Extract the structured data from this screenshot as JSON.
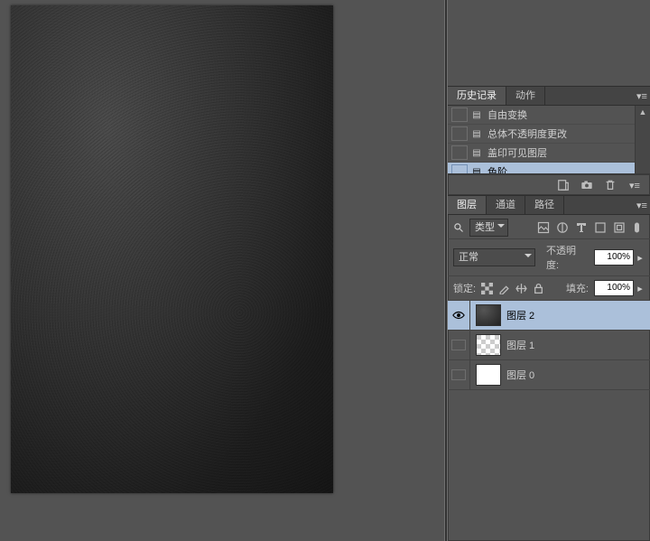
{
  "history_panel": {
    "tabs": {
      "history": "历史记录",
      "actions": "动作"
    },
    "items": [
      {
        "label": "自由变换"
      },
      {
        "label": "总体不透明度更改"
      },
      {
        "label": "盖印可见图层"
      },
      {
        "label": "色阶"
      }
    ],
    "selected_index": 3
  },
  "layers_panel": {
    "tabs": {
      "layers": "图层",
      "channels": "通道",
      "paths": "路径"
    },
    "filter_kind": "类型",
    "blend_mode": "正常",
    "opacity_label": "不透明度:",
    "opacity_value": "100%",
    "lock_label": "锁定:",
    "fill_label": "填充:",
    "fill_value": "100%",
    "layers": [
      {
        "name": "图层 2",
        "thumb": "dark",
        "visible": true
      },
      {
        "name": "图层 1",
        "thumb": "checker",
        "visible": false
      },
      {
        "name": "图层 0",
        "thumb": "white",
        "visible": false
      }
    ],
    "selected_index": 0
  }
}
